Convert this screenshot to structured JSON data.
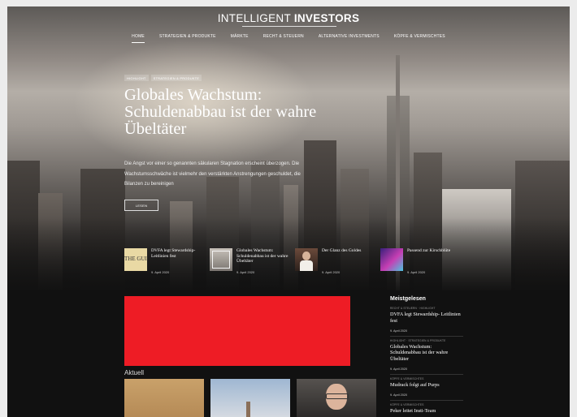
{
  "header": {
    "title_light": "INTELLIGENT ",
    "title_bold": "INVESTORS"
  },
  "nav": {
    "items": [
      {
        "label": "HOME"
      },
      {
        "label": "STRATEGIEN & PRODUKTE"
      },
      {
        "label": "MÄRKTE"
      },
      {
        "label": "RECHT & STEUERN"
      },
      {
        "label": "ALTERNATIVE INVESTMENTS"
      },
      {
        "label": "KÖPFE & VERMISCHTES"
      }
    ]
  },
  "hero": {
    "tags": [
      "HIGHLIGHT",
      "STRATEGIEN & PRODUKTE"
    ],
    "title": "Globales Wachstum: Schuldenabbau ist der wahre Übeltäter",
    "teaser": "Die Angst vor einer so genannten säkularen Stagnation erscheint überzogen. Die Wachstumsschwäche ist vielmehr den verstärkten Anstrengungen geschuldet, die Bilanzen zu bereinigen",
    "button": "LESEN"
  },
  "teasers": [
    {
      "title": "DVFA legt Stewardship-Leitlinien fest",
      "date": "9. April 2020",
      "thumb_text": "THE GUI"
    },
    {
      "title": "Globales Wachstum: Schuldenabbau ist der wahre Übeltäter",
      "date": "9. April 2020"
    },
    {
      "title": "Der Glanz des Goldes",
      "date": "9. April 2020"
    },
    {
      "title": "Passend zur Kirschblüte",
      "date": "9. April 2020"
    }
  ],
  "main": {
    "section_title": "Aktuell"
  },
  "sidebar": {
    "title": "Meistgelesen",
    "items": [
      {
        "tags": "RECHT & STEUERN · HIGHLIGHT",
        "title": "DVFA legt Stewardship- Leitlinien fest",
        "date": "9. April 2020"
      },
      {
        "tags": "HIGHLIGHT · STRATEGIEN & PRODUKTE",
        "title": "Globales Wachstum: Schuldenabbau ist der wahre Übeltäter",
        "date": "9. April 2020"
      },
      {
        "tags": "KÖPFE & VERMISCHTES",
        "title": "Mudrack folgt auf Purps",
        "date": "9. April 2020"
      },
      {
        "tags": "KÖPFE & VERMISCHTES",
        "title": "Peker leitet Insti-Team",
        "date": ""
      }
    ]
  },
  "colors": {
    "ad_banner": "#ee1c25",
    "background": "#111111"
  }
}
